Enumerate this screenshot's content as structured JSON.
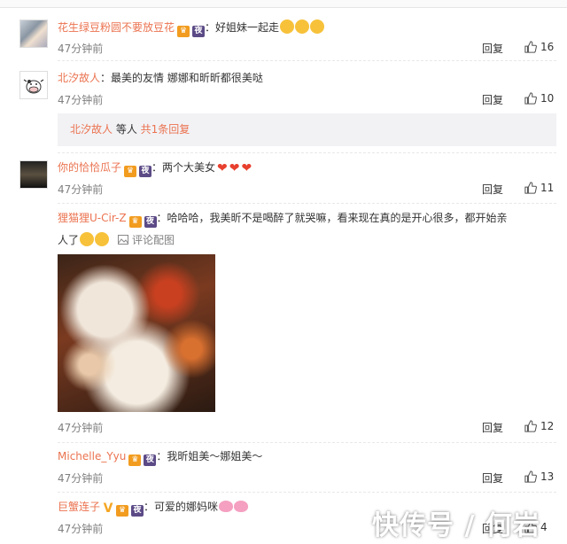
{
  "comments": [
    {
      "user": "花生绿豆粉圆不要放豆花",
      "text": "：好姐妹一起走",
      "time": "47分钟前",
      "reply": "回复",
      "likes": "16",
      "avatar": "avatar-girl"
    },
    {
      "user": "北汐故人",
      "text": "：最美的友情 娜娜和昕昕都很美哒",
      "time": "47分钟前",
      "reply": "回复",
      "likes": "10",
      "avatar": "avatar-cow",
      "subreply": {
        "user": "北汐故人",
        "mid": " 等人 ",
        "count": "共1条回复"
      }
    },
    {
      "user": "你的恰恰瓜子",
      "text": "：两个大美女",
      "time": "47分钟前",
      "reply": "回复",
      "likes": "11",
      "avatar": "avatar-dark"
    },
    {
      "user": "狸猫狸U-Cir-Z",
      "text": "：哈哈哈，我美昕不是喝醉了就哭嘛，看来现在真的是开心很多，都开始亲",
      "text2": "人了",
      "pic_link": "评论配图",
      "time": "47分钟前",
      "reply": "回复",
      "likes": "12"
    },
    {
      "user": "Michelle_Yyu",
      "text": "：我昕姐美～娜姐美～",
      "time": "47分钟前",
      "reply": "回复",
      "likes": "13"
    },
    {
      "user": "巨蟹连子",
      "text": "：可爱的娜妈咪",
      "time": "47分钟前",
      "reply": "回复",
      "likes": "4"
    }
  ],
  "badges": {
    "crown": "♛",
    "night": "夜",
    "v": "V"
  },
  "watermark": "快传号 / 何岩",
  "colors": {
    "username": "#eb7350",
    "time": "#808080",
    "subbox_bg": "#f2f2f5"
  }
}
